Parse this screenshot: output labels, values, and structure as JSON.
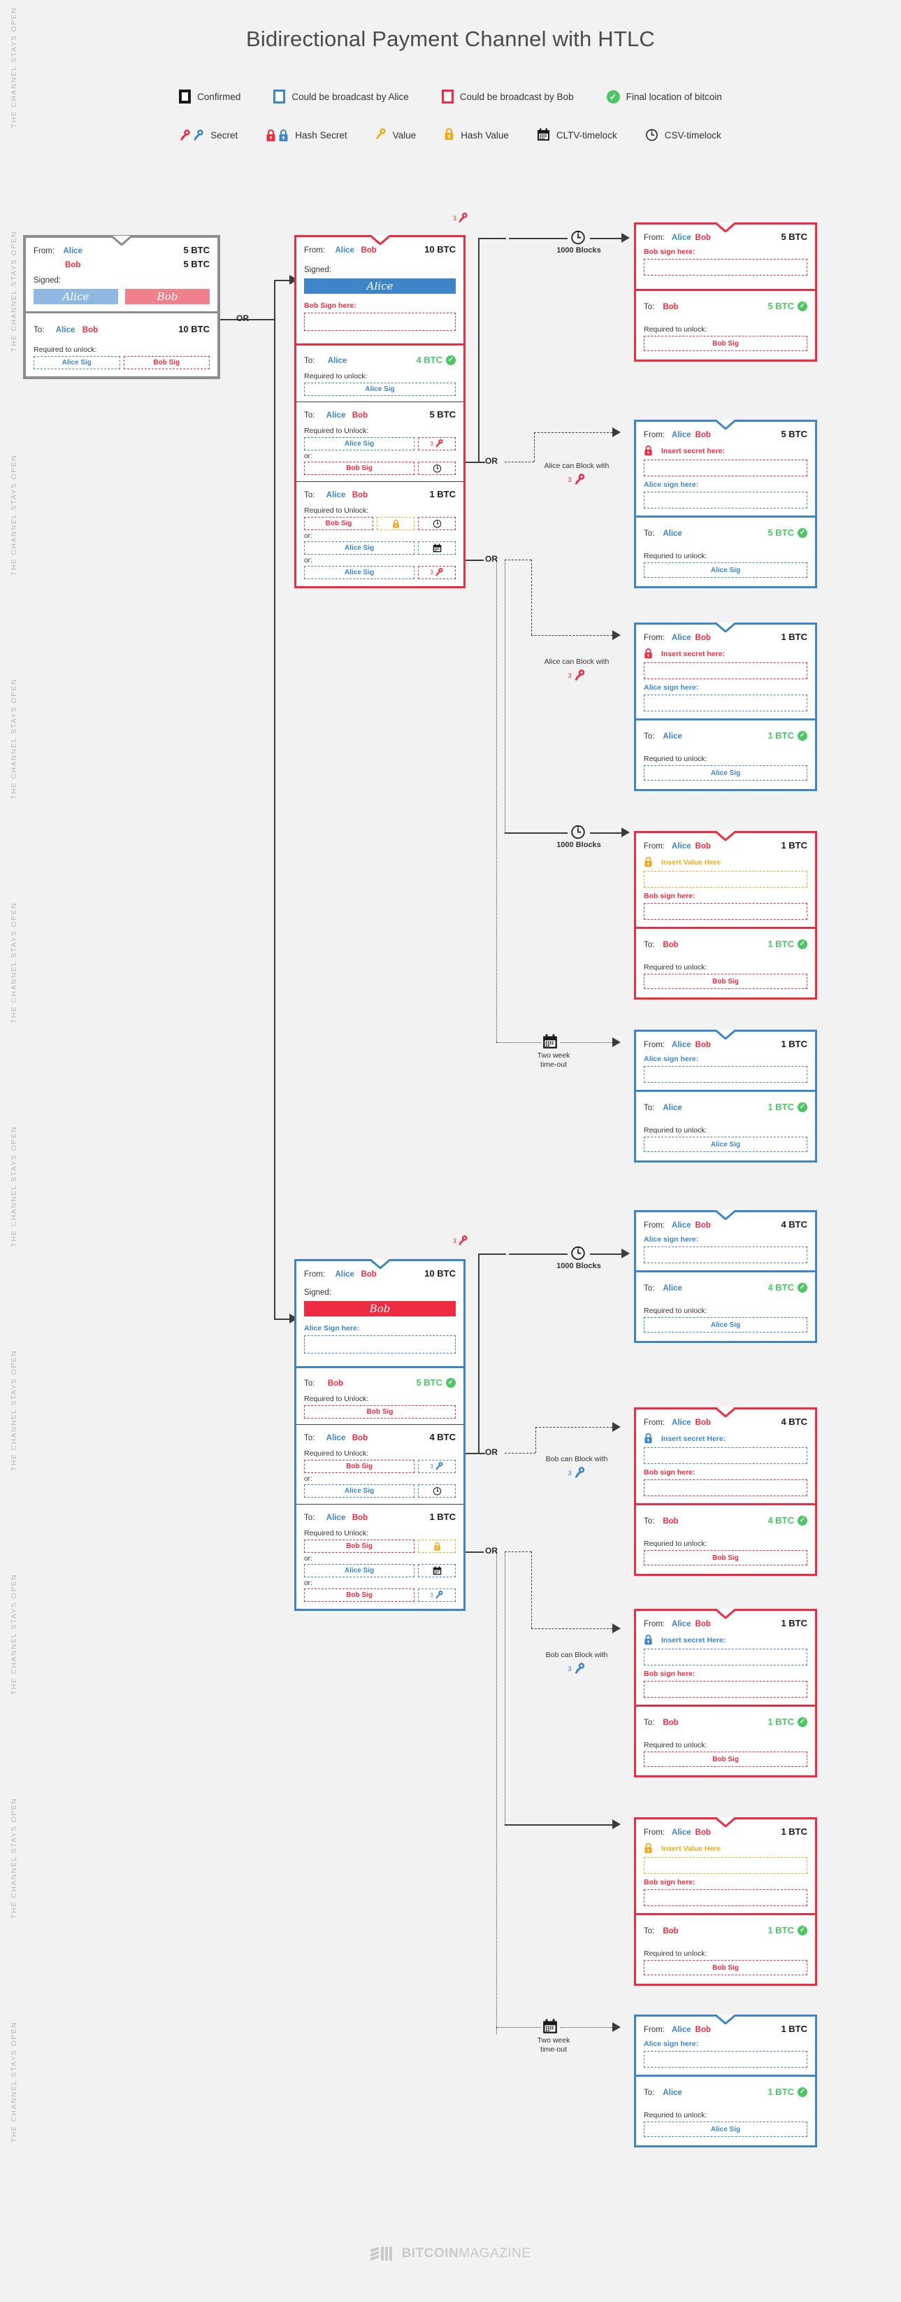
{
  "title": "Bidirectional Payment Channel with HTLC",
  "legend": {
    "row1": [
      {
        "icon": "confirmed-square-icon",
        "label": "Confirmed"
      },
      {
        "icon": "alice-square-icon",
        "label": "Could be broadcast by Alice"
      },
      {
        "icon": "bob-square-icon",
        "label": "Could be broadcast by Bob"
      },
      {
        "icon": "check-circle-icon",
        "label": "Final location of bitcoin"
      }
    ],
    "row2": [
      {
        "icon": "key-pair-icon",
        "label": "Secret"
      },
      {
        "icon": "lock-pair-icon",
        "label": "Hash Secret"
      },
      {
        "icon": "gold-key-icon",
        "label": "Value"
      },
      {
        "icon": "gold-lock-icon",
        "label": "Hash Value"
      },
      {
        "icon": "calendar-icon",
        "label": "CLTV-timelock"
      },
      {
        "icon": "clock-icon",
        "label": "CSV-timelock"
      }
    ]
  },
  "side_text": "THE CHANNEL STAYS OPEN",
  "labels": {
    "from": "From:",
    "to": "To:",
    "signed": "Signed:",
    "alice": "Alice",
    "bob": "Bob",
    "alice_sig": "Alice Sig",
    "bob_sig": "Bob Sig",
    "required_unlock_lower": "Required to unlock:",
    "required_unlock_upper": "Required to Unlock:",
    "required_unlock_typo": "Requried to unlock:",
    "or": "or:",
    "OR": "OR",
    "bob_sign_here_caps": "Bob Sign here:",
    "bob_sign_here": "Bob sign here:",
    "alice_sign_here_caps": "Alice Sign here:",
    "alice_sign_here": "Alice sign here:",
    "insert_secret_here": "Insert secret here:",
    "insert_secret_here_caps": "Insert secret Here:",
    "insert_value_here": "Insert Value Here",
    "thousand_blocks": "1000 Blocks",
    "two_week_timeout": "Two week\ntime-out",
    "alice_can_block": "Alice can Block with",
    "bob_can_block": "Bob can Block with",
    "key_number": "3"
  },
  "colors": {
    "alice": "#3d85c8",
    "bob": "#ed2b41",
    "confirmed": "#8d8d8d",
    "final": "#4cc764",
    "value": "#efab1d",
    "background": "#f2f2f2"
  },
  "cards": {
    "funding": {
      "from_label": "From:",
      "from_alice": "Alice",
      "from_bob": "Bob",
      "amt_alice": "5 BTC",
      "amt_bob": "5 BTC",
      "signed": "Signed:",
      "sig_alice": "Alice",
      "sig_bob": "Bob",
      "to_label": "To:",
      "to_alice": "Alice",
      "to_bob": "Bob",
      "to_amount": "10 BTC",
      "required": "Required to unlock:",
      "slot_alice": "Alice Sig",
      "slot_bob": "Bob Sig"
    },
    "commit_alice": {
      "from_label": "From:",
      "from_alice": "Alice",
      "from_bob": "Bob",
      "from_amount": "10 BTC",
      "signed": "Signed:",
      "signature": "Alice",
      "sign_prompt": "Bob Sign here:",
      "out1": {
        "to": "To:",
        "who": "Alice",
        "amount": "4 BTC",
        "required": "Required to unlock:",
        "slot": "Alice Sig"
      },
      "out2": {
        "to": "To:",
        "alice": "Alice",
        "bob": "Bob",
        "amount": "5 BTC",
        "required": "Required to Unlock:",
        "rows": [
          {
            "left": "Alice Sig",
            "leftc": "blue",
            "right": "key",
            "rightc": "red",
            "num": "3"
          },
          {
            "left": "Bob Sig",
            "leftc": "red",
            "right": "clock",
            "rightc": "red",
            "num": ""
          }
        ]
      },
      "out3": {
        "to": "To:",
        "alice": "Alice",
        "bob": "Bob",
        "amount": "1 BTC",
        "required": "Required to Unlock:",
        "rows": [
          {
            "left": "Bob Sig",
            "leftc": "red",
            "mid": "goldlock",
            "right": "clock",
            "rightc": "red"
          },
          {
            "left": "Alice Sig",
            "leftc": "blue",
            "right": "calendar",
            "rightc": "blue"
          },
          {
            "left": "Alice Sig",
            "leftc": "blue",
            "right": "key",
            "rightc": "red",
            "num": "3"
          }
        ]
      }
    },
    "commit_bob": {
      "from_label": "From:",
      "from_alice": "Alice",
      "from_bob": "Bob",
      "from_amount": "10 BTC",
      "signed": "Signed:",
      "signature": "Bob",
      "sign_prompt": "Alice Sign here:",
      "out1": {
        "to": "To:",
        "who": "Bob",
        "amount": "5 BTC",
        "required": "Required to Unlock:",
        "slot": "Bob Sig"
      },
      "out2": {
        "to": "To:",
        "alice": "Alice",
        "bob": "Bob",
        "amount": "4 BTC",
        "required": "Required to Unlock:",
        "rows": [
          {
            "left": "Bob Sig",
            "leftc": "red",
            "right": "key",
            "rightc": "blue",
            "num": "3"
          },
          {
            "left": "Alice Sig",
            "leftc": "blue",
            "right": "clock",
            "rightc": "blue",
            "num": ""
          }
        ]
      },
      "out3": {
        "to": "To:",
        "alice": "Alice",
        "bob": "Bob",
        "amount": "1 BTC",
        "required": "Required to Unlock:",
        "rows": [
          {
            "left": "Bob Sig",
            "leftc": "red",
            "right": "goldlock",
            "rightc": "gold"
          },
          {
            "left": "Alice Sig",
            "leftc": "blue",
            "right": "calendar",
            "rightc": "blue"
          },
          {
            "left": "Bob Sig",
            "leftc": "red",
            "right": "key",
            "rightc": "blue",
            "num": "3"
          }
        ]
      }
    },
    "right": [
      {
        "id": "r1",
        "border": "r",
        "from": {
          "alice": "Alice",
          "bob": "Bob",
          "amount": "5 BTC"
        },
        "prompts": [
          {
            "label": "Bob sign here:",
            "color": "r",
            "box": "d-red",
            "lock": null
          }
        ],
        "to": {
          "who": "Bob",
          "whoColor": "bob",
          "amount": "5 BTC",
          "check": true,
          "required": "Required to unlock:",
          "slot": "Bob Sig",
          "slotc": "red"
        },
        "connector": {
          "type": "clock",
          "label": "1000 Blocks"
        }
      },
      {
        "id": "r2",
        "border": "b",
        "from": {
          "alice": "Alice",
          "bob": "Bob",
          "amount": "5 BTC"
        },
        "prompts": [
          {
            "label": "Insert secret here:",
            "color": "r",
            "box": "d-red",
            "lock": "red"
          },
          {
            "label": "Alice sign here:",
            "color": "b",
            "box": "d-blue",
            "lock": null
          }
        ],
        "to": {
          "who": "Alice",
          "whoColor": "alice",
          "amount": "5 BTC",
          "check": true,
          "required": "Requried to unlock:",
          "slot": "Alice Sig",
          "slotc": "blue"
        },
        "connector": {
          "type": "block",
          "label": "Alice can Block with",
          "key": "red",
          "num": "3"
        }
      },
      {
        "id": "r3",
        "border": "b",
        "from": {
          "alice": "Alice",
          "bob": "Bob",
          "amount": "1 BTC"
        },
        "prompts": [
          {
            "label": "Insert secret here:",
            "color": "r",
            "box": "d-red",
            "lock": "red"
          },
          {
            "label": "Alice sign here:",
            "color": "b",
            "box": "d-blue",
            "lock": null
          }
        ],
        "to": {
          "who": "Alice",
          "whoColor": "alice",
          "amount": "1 BTC",
          "check": true,
          "required": "Requried to unlock:",
          "slot": "Alice Sig",
          "slotc": "blue"
        },
        "connector": {
          "type": "block",
          "label": "Alice can Block with",
          "key": "red",
          "num": "3"
        }
      },
      {
        "id": "r4",
        "border": "r",
        "from": {
          "alice": "Alice",
          "bob": "Bob",
          "amount": "1 BTC"
        },
        "prompts": [
          {
            "label": "Insert Value Here",
            "color": "g",
            "box": "d-gold",
            "lock": "gold"
          },
          {
            "label": "Bob sign here:",
            "color": "r",
            "box": "d-red",
            "lock": null
          }
        ],
        "to": {
          "who": "Bob",
          "whoColor": "bob",
          "amount": "1 BTC",
          "check": true,
          "required": "Required to unlock:",
          "slot": "Bob Sig",
          "slotc": "red"
        },
        "connector": {
          "type": "clock",
          "label": "1000 Blocks"
        }
      },
      {
        "id": "r5",
        "border": "b",
        "from": {
          "alice": "Alice",
          "bob": "Bob",
          "amount": "1 BTC"
        },
        "prompts": [
          {
            "label": "Alice sign here:",
            "color": "b",
            "box": "d-blue",
            "lock": null
          }
        ],
        "to": {
          "who": "Alice",
          "whoColor": "alice",
          "amount": "1 BTC",
          "check": true,
          "required": "Requried to unlock:",
          "slot": "Alice Sig",
          "slotc": "blue"
        },
        "connector": {
          "type": "calendar",
          "label": "Two week\ntime-out"
        }
      },
      {
        "id": "r6",
        "border": "b",
        "from": {
          "alice": "Alice",
          "bob": "Bob",
          "amount": "4 BTC"
        },
        "prompts": [
          {
            "label": "Alice sign here:",
            "color": "b",
            "box": "d-blue",
            "lock": null
          }
        ],
        "to": {
          "who": "Alice",
          "whoColor": "alice",
          "amount": "4 BTC",
          "check": true,
          "required": "Required to unlock:",
          "slot": "Alice Sig",
          "slotc": "blue"
        },
        "connector": {
          "type": "clock",
          "label": "1000 Blocks"
        }
      },
      {
        "id": "r7",
        "border": "r",
        "from": {
          "alice": "Alice",
          "bob": "Bob",
          "amount": "4 BTC"
        },
        "prompts": [
          {
            "label": "Insert secret Here:",
            "color": "b",
            "box": "d-blue",
            "lock": "blue"
          },
          {
            "label": "Bob sign here:",
            "color": "r",
            "box": "d-red",
            "lock": null
          }
        ],
        "to": {
          "who": "Bob",
          "whoColor": "bob",
          "amount": "4 BTC",
          "check": true,
          "required": "Requried to unlock:",
          "slot": "Bob Sig",
          "slotc": "red"
        },
        "connector": {
          "type": "block",
          "label": "Bob can Block with",
          "key": "blue",
          "num": "3"
        }
      },
      {
        "id": "r8",
        "border": "r",
        "from": {
          "alice": "Alice",
          "bob": "Bob",
          "amount": "1 BTC"
        },
        "prompts": [
          {
            "label": "Insert secret Here:",
            "color": "b",
            "box": "d-blue",
            "lock": "blue"
          },
          {
            "label": "Bob sign here:",
            "color": "r",
            "box": "d-red",
            "lock": null
          }
        ],
        "to": {
          "who": "Bob",
          "whoColor": "bob",
          "amount": "1 BTC",
          "check": true,
          "required": "Required to unlock:",
          "slot": "Bob Sig",
          "slotc": "red"
        },
        "connector": {
          "type": "block",
          "label": "Bob can Block with",
          "key": "blue",
          "num": "3"
        }
      },
      {
        "id": "r9",
        "border": "r",
        "from": {
          "alice": "Alice",
          "bob": "Bob",
          "amount": "1 BTC"
        },
        "prompts": [
          {
            "label": "Insert Value Here",
            "color": "g",
            "box": "d-gold",
            "lock": "gold"
          },
          {
            "label": "Bob sign here:",
            "color": "r",
            "box": "d-red",
            "lock": null
          }
        ],
        "to": {
          "who": "Bob",
          "whoColor": "bob",
          "amount": "1 BTC",
          "check": true,
          "required": "Required to unlock:",
          "slot": "Bob Sig",
          "slotc": "red"
        },
        "connector": {
          "type": "plain",
          "label": ""
        }
      },
      {
        "id": "r10",
        "border": "b",
        "from": {
          "alice": "Alice",
          "bob": "Bob",
          "amount": "1 BTC"
        },
        "prompts": [
          {
            "label": "Alice sign here:",
            "color": "b",
            "box": "d-blue",
            "lock": null
          }
        ],
        "to": {
          "who": "Alice",
          "whoColor": "alice",
          "amount": "1 BTC",
          "check": true,
          "required": "Requried to unlock:",
          "slot": "Alice Sig",
          "slotc": "blue"
        },
        "connector": {
          "type": "calendar",
          "label": "Two week\ntime-out"
        }
      }
    ]
  },
  "footer": {
    "brand_bold": "BITCOIN",
    "brand_light": "MAGAZINE"
  }
}
